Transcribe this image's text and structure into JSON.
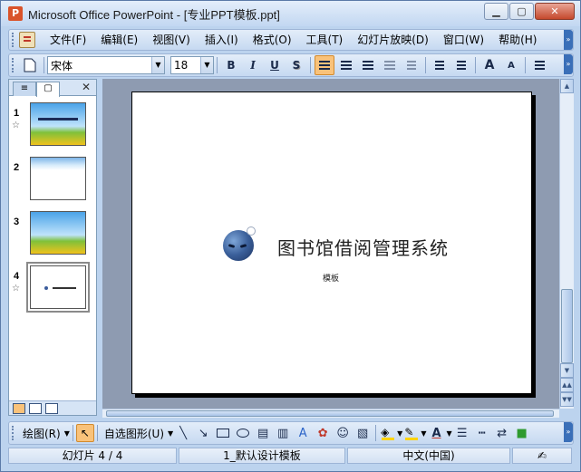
{
  "window": {
    "title": "Microsoft Office PowerPoint - [专业PPT模板.ppt]",
    "app_icon": "P",
    "controls": {
      "minimize": "▁",
      "maximize": "▢",
      "close": "✕"
    }
  },
  "menu": {
    "items": [
      "文件(F)",
      "编辑(E)",
      "视图(V)",
      "插入(I)",
      "格式(O)",
      "工具(T)",
      "幻灯片放映(D)",
      "窗口(W)",
      "帮助(H)"
    ]
  },
  "format_toolbar": {
    "font_name": "宋体",
    "font_size": "18",
    "bold": "B",
    "italic": "I",
    "underline": "U",
    "shadow": "S",
    "increase_font": "A",
    "decrease_font": "A"
  },
  "panel": {
    "close": "✕",
    "slides": [
      {
        "number": "1",
        "star": "☆"
      },
      {
        "number": "2",
        "star": ""
      },
      {
        "number": "3",
        "star": ""
      },
      {
        "number": "4",
        "star": "☆"
      }
    ]
  },
  "slide": {
    "title": "图书馆借阅管理系统",
    "subtitle": "模板"
  },
  "drawing_toolbar": {
    "draw_label": "绘图(R)",
    "autoshapes_label": "自选图形(U)"
  },
  "status": {
    "slide_count": "幻灯片 4 / 4",
    "design": "1_默认设计模板",
    "language": "中文(中国)"
  },
  "colors": {
    "title_bar": "#c2d7f1",
    "canvas": "#8e9bb1",
    "accent": "#f9c27a"
  }
}
